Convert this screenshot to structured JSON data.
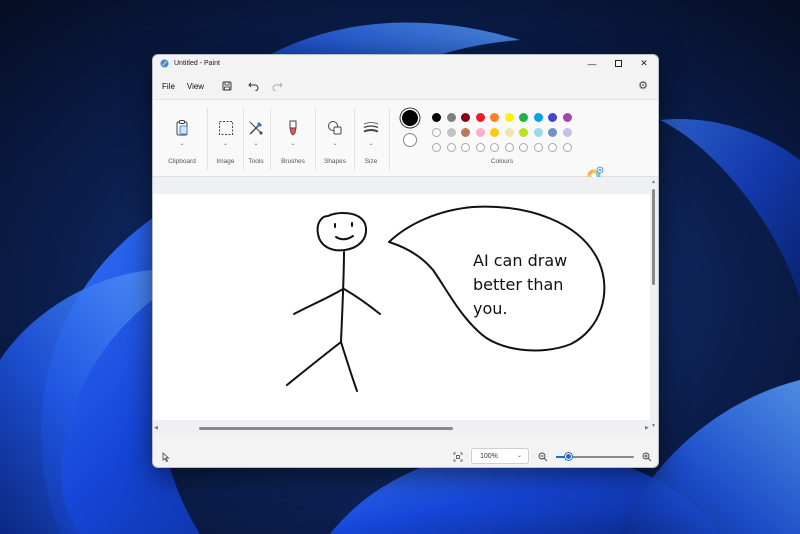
{
  "window": {
    "title": "Untitled - Paint"
  },
  "menu": {
    "file": "File",
    "view": "View"
  },
  "ribbon": {
    "groups": [
      {
        "label": "Clipboard",
        "icon": "clipboard-icon"
      },
      {
        "label": "Image",
        "icon": "select-icon"
      },
      {
        "label": "Tools",
        "icon": "tools-icon"
      },
      {
        "label": "Brushes",
        "icon": "brush-icon"
      },
      {
        "label": "Shapes",
        "icon": "shapes-icon"
      },
      {
        "label": "Size",
        "icon": "size-icon"
      }
    ],
    "colours_label": "Colours",
    "primary_colour": "#000000",
    "secondary_colour": "#ffffff",
    "palette_row1": [
      "#000000",
      "#7f7f7f",
      "#880015",
      "#ed1c24",
      "#ff7f27",
      "#fff200",
      "#22b14c",
      "#00a2e8",
      "#3f48cc",
      "#a349a4"
    ],
    "palette_row2": [
      "#ffffff",
      "#c3c3c3",
      "#b97a57",
      "#ffaec9",
      "#ffc90e",
      "#efe4b0",
      "#b5e61d",
      "#99d9ea",
      "#7092be",
      "#c8bfe7"
    ]
  },
  "canvas": {
    "speech_text": "AI can draw\nbetter than\nyou."
  },
  "status": {
    "zoom": "100%",
    "zoom_level": 0.15
  }
}
